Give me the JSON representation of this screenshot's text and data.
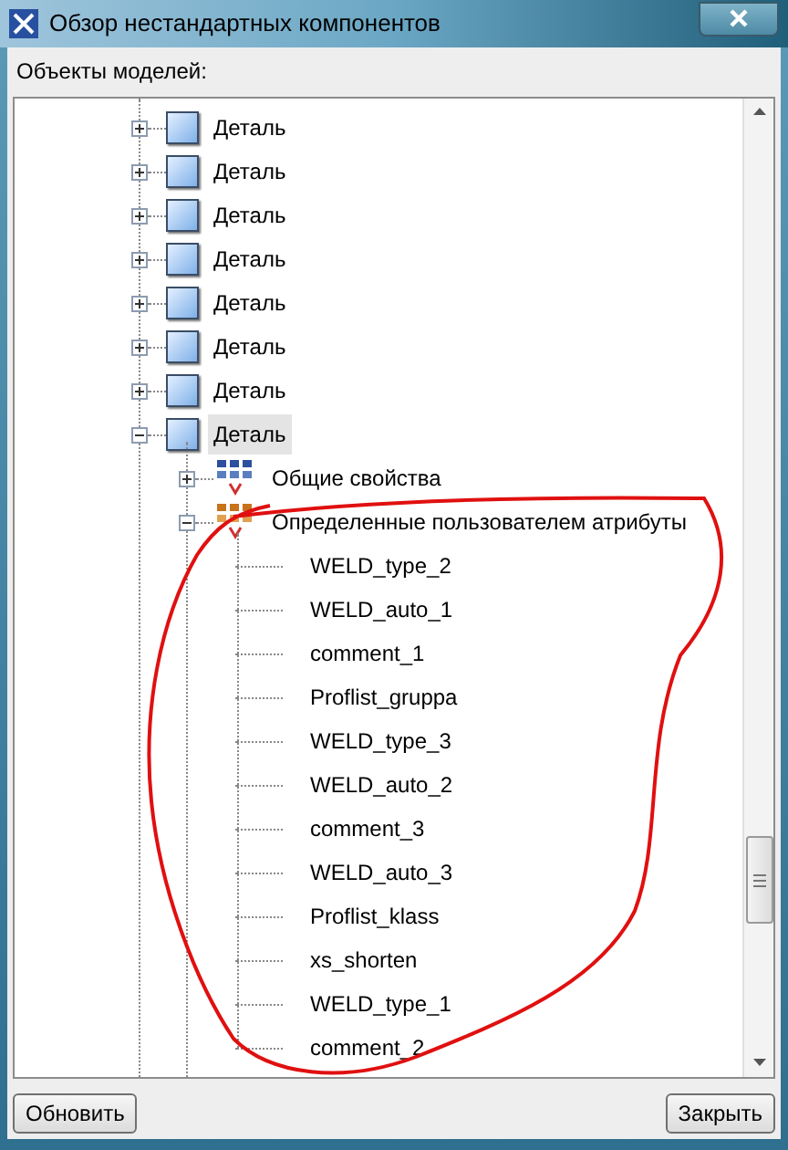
{
  "window": {
    "title": "Обзор нестандартных компонентов"
  },
  "tree_label": "Объекты моделей:",
  "tree": [
    {
      "kind": "part",
      "label": "Деталь",
      "expanded": false,
      "selected": false
    },
    {
      "kind": "part",
      "label": "Деталь",
      "expanded": false,
      "selected": false
    },
    {
      "kind": "part",
      "label": "Деталь",
      "expanded": false,
      "selected": false
    },
    {
      "kind": "part",
      "label": "Деталь",
      "expanded": false,
      "selected": false
    },
    {
      "kind": "part",
      "label": "Деталь",
      "expanded": false,
      "selected": false
    },
    {
      "kind": "part",
      "label": "Деталь",
      "expanded": false,
      "selected": false
    },
    {
      "kind": "part",
      "label": "Деталь",
      "expanded": false,
      "selected": false
    },
    {
      "kind": "part",
      "label": "Деталь",
      "expanded": true,
      "selected": true,
      "children": [
        {
          "kind": "general",
          "label": "Общие свойства",
          "expanded": false,
          "selected": false
        },
        {
          "kind": "user",
          "label": "Определенные пользователем атрибуты",
          "expanded": true,
          "selected": false,
          "children": [
            {
              "kind": "attribute",
              "label": "WELD_type_2",
              "selected": false
            },
            {
              "kind": "attribute",
              "label": "WELD_auto_1",
              "selected": false
            },
            {
              "kind": "attribute",
              "label": "comment_1",
              "selected": false
            },
            {
              "kind": "attribute",
              "label": "Proflist_gruppa",
              "selected": false
            },
            {
              "kind": "attribute",
              "label": "WELD_type_3",
              "selected": false
            },
            {
              "kind": "attribute",
              "label": "WELD_auto_2",
              "selected": false
            },
            {
              "kind": "attribute",
              "label": "comment_3",
              "selected": false
            },
            {
              "kind": "attribute",
              "label": "WELD_auto_3",
              "selected": false
            },
            {
              "kind": "attribute",
              "label": "Proflist_klass",
              "selected": false
            },
            {
              "kind": "attribute",
              "label": "xs_shorten",
              "selected": false
            },
            {
              "kind": "attribute",
              "label": "WELD_type_1",
              "selected": false
            },
            {
              "kind": "attribute",
              "label": "comment_2",
              "selected": false
            }
          ]
        }
      ]
    }
  ],
  "buttons": [
    {
      "label": "Обновить"
    },
    {
      "label": "Закрыть"
    }
  ]
}
